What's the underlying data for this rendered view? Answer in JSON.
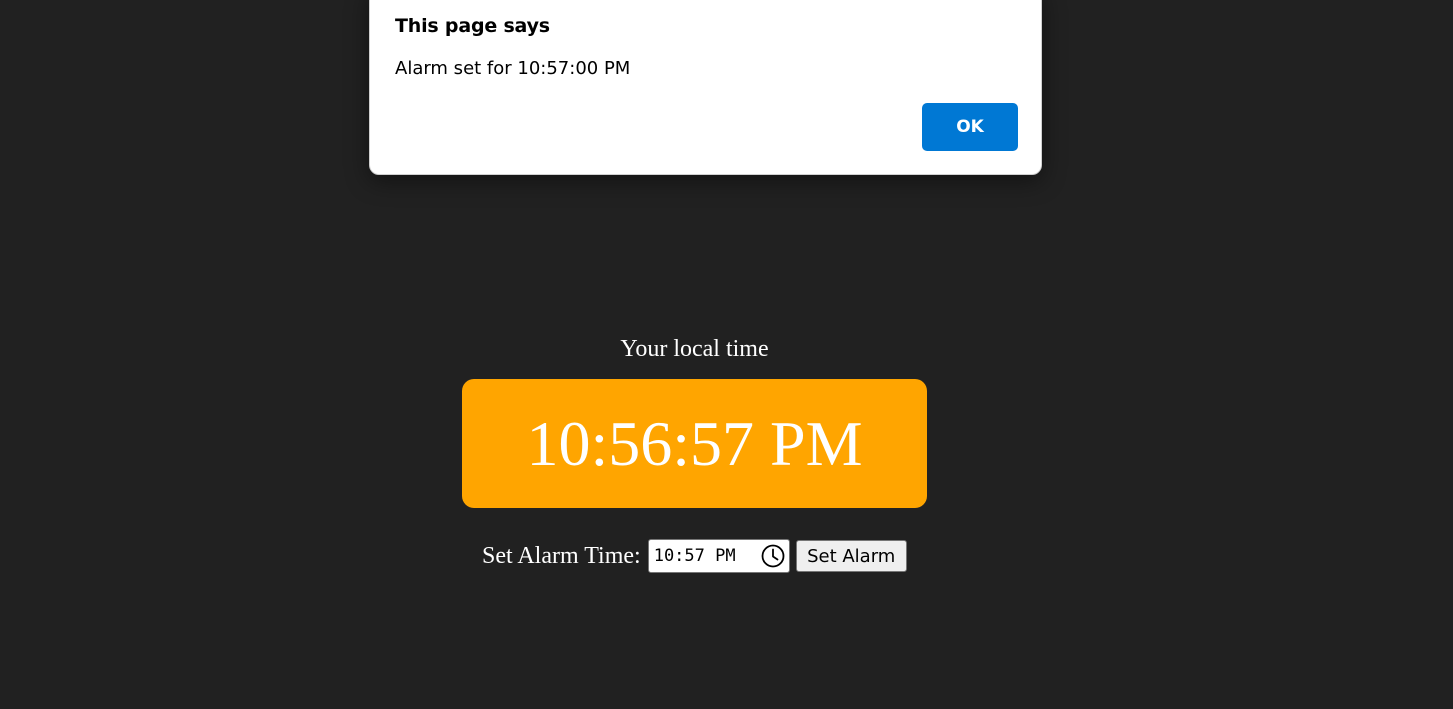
{
  "dialog": {
    "title": "This page says",
    "message": "Alarm set for 10:57:00 PM",
    "ok_label": "OK"
  },
  "clock": {
    "label": "Your local time",
    "time": "10:56:57 PM"
  },
  "alarm": {
    "label": "Set Alarm Time:",
    "input_value": "10:57 PM",
    "button_label": "Set Alarm"
  },
  "colors": {
    "background": "#212121",
    "clock_box": "#ffa500",
    "dialog_button": "#0078d4"
  },
  "icons": {
    "time_picker": "clock-icon"
  }
}
